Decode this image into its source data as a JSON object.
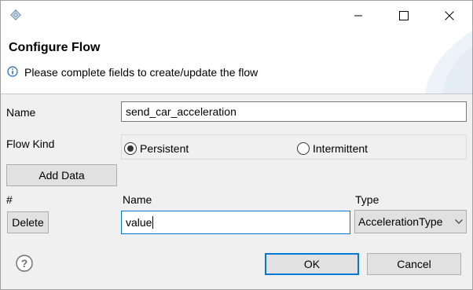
{
  "window": {
    "title": ""
  },
  "header": {
    "title": "Configure Flow",
    "message": "Please complete fields to create/update the flow"
  },
  "form": {
    "name_label": "Name",
    "name_value": "send_car_acceleration",
    "flow_kind_label": "Flow Kind",
    "options": [
      {
        "label": "Persistent",
        "selected": true
      },
      {
        "label": "Intermittent",
        "selected": false
      }
    ],
    "add_data_label": "Add Data"
  },
  "table": {
    "headers": {
      "index": "#",
      "name": "Name",
      "type": "Type"
    },
    "rows": [
      {
        "delete_label": "Delete",
        "name": "value",
        "type": "AccelerationType"
      }
    ]
  },
  "footer": {
    "ok_label": "OK",
    "cancel_label": "Cancel"
  },
  "icons": {
    "app": "app-icon",
    "info": "info-icon",
    "help": "help-icon",
    "minimize": "minimize-icon",
    "maximize": "maximize-icon",
    "close": "close-icon",
    "dropdown": "chevron-down-icon"
  },
  "colors": {
    "accent": "#0078d7",
    "info": "#1a64b4"
  }
}
